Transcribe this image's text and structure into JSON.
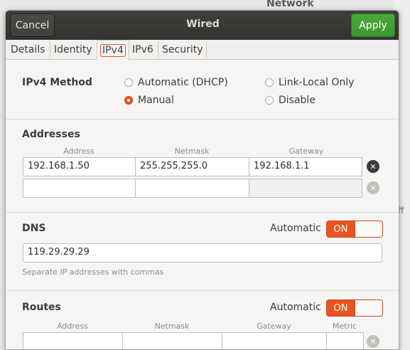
{
  "background": {
    "window_title": "Network",
    "partial_text": "ff"
  },
  "dialog": {
    "title": "Wired",
    "cancel_label": "Cancel",
    "apply_label": "Apply"
  },
  "tabs": [
    {
      "label": "Details"
    },
    {
      "label": "Identity"
    },
    {
      "label": "IPv4"
    },
    {
      "label": "IPv6"
    },
    {
      "label": "Security"
    }
  ],
  "ipv4": {
    "method_label": "IPv4 Method",
    "methods": [
      {
        "label": "Automatic (DHCP)",
        "checked": false
      },
      {
        "label": "Link-Local Only",
        "checked": false
      },
      {
        "label": "Manual",
        "checked": true
      },
      {
        "label": "Disable",
        "checked": false
      }
    ]
  },
  "addresses": {
    "heading": "Addresses",
    "columns": [
      "Address",
      "Netmask",
      "Gateway"
    ],
    "rows": [
      {
        "address": "192.168.1.50",
        "netmask": "255.255.255.0",
        "gateway": "192.168.1.1"
      },
      {
        "address": "",
        "netmask": "",
        "gateway": ""
      }
    ]
  },
  "dns": {
    "heading": "DNS",
    "automatic_label": "Automatic",
    "switch_label": "ON",
    "value": "119.29.29.29",
    "hint": "Separate IP addresses with commas"
  },
  "routes": {
    "heading": "Routes",
    "automatic_label": "Automatic",
    "switch_label": "ON",
    "columns": [
      "Address",
      "Netmask",
      "Gateway",
      "Metric"
    ]
  },
  "colors": {
    "accent": "#e95420",
    "apply_green": "#45a135",
    "headerbar": "#3a3a37"
  }
}
